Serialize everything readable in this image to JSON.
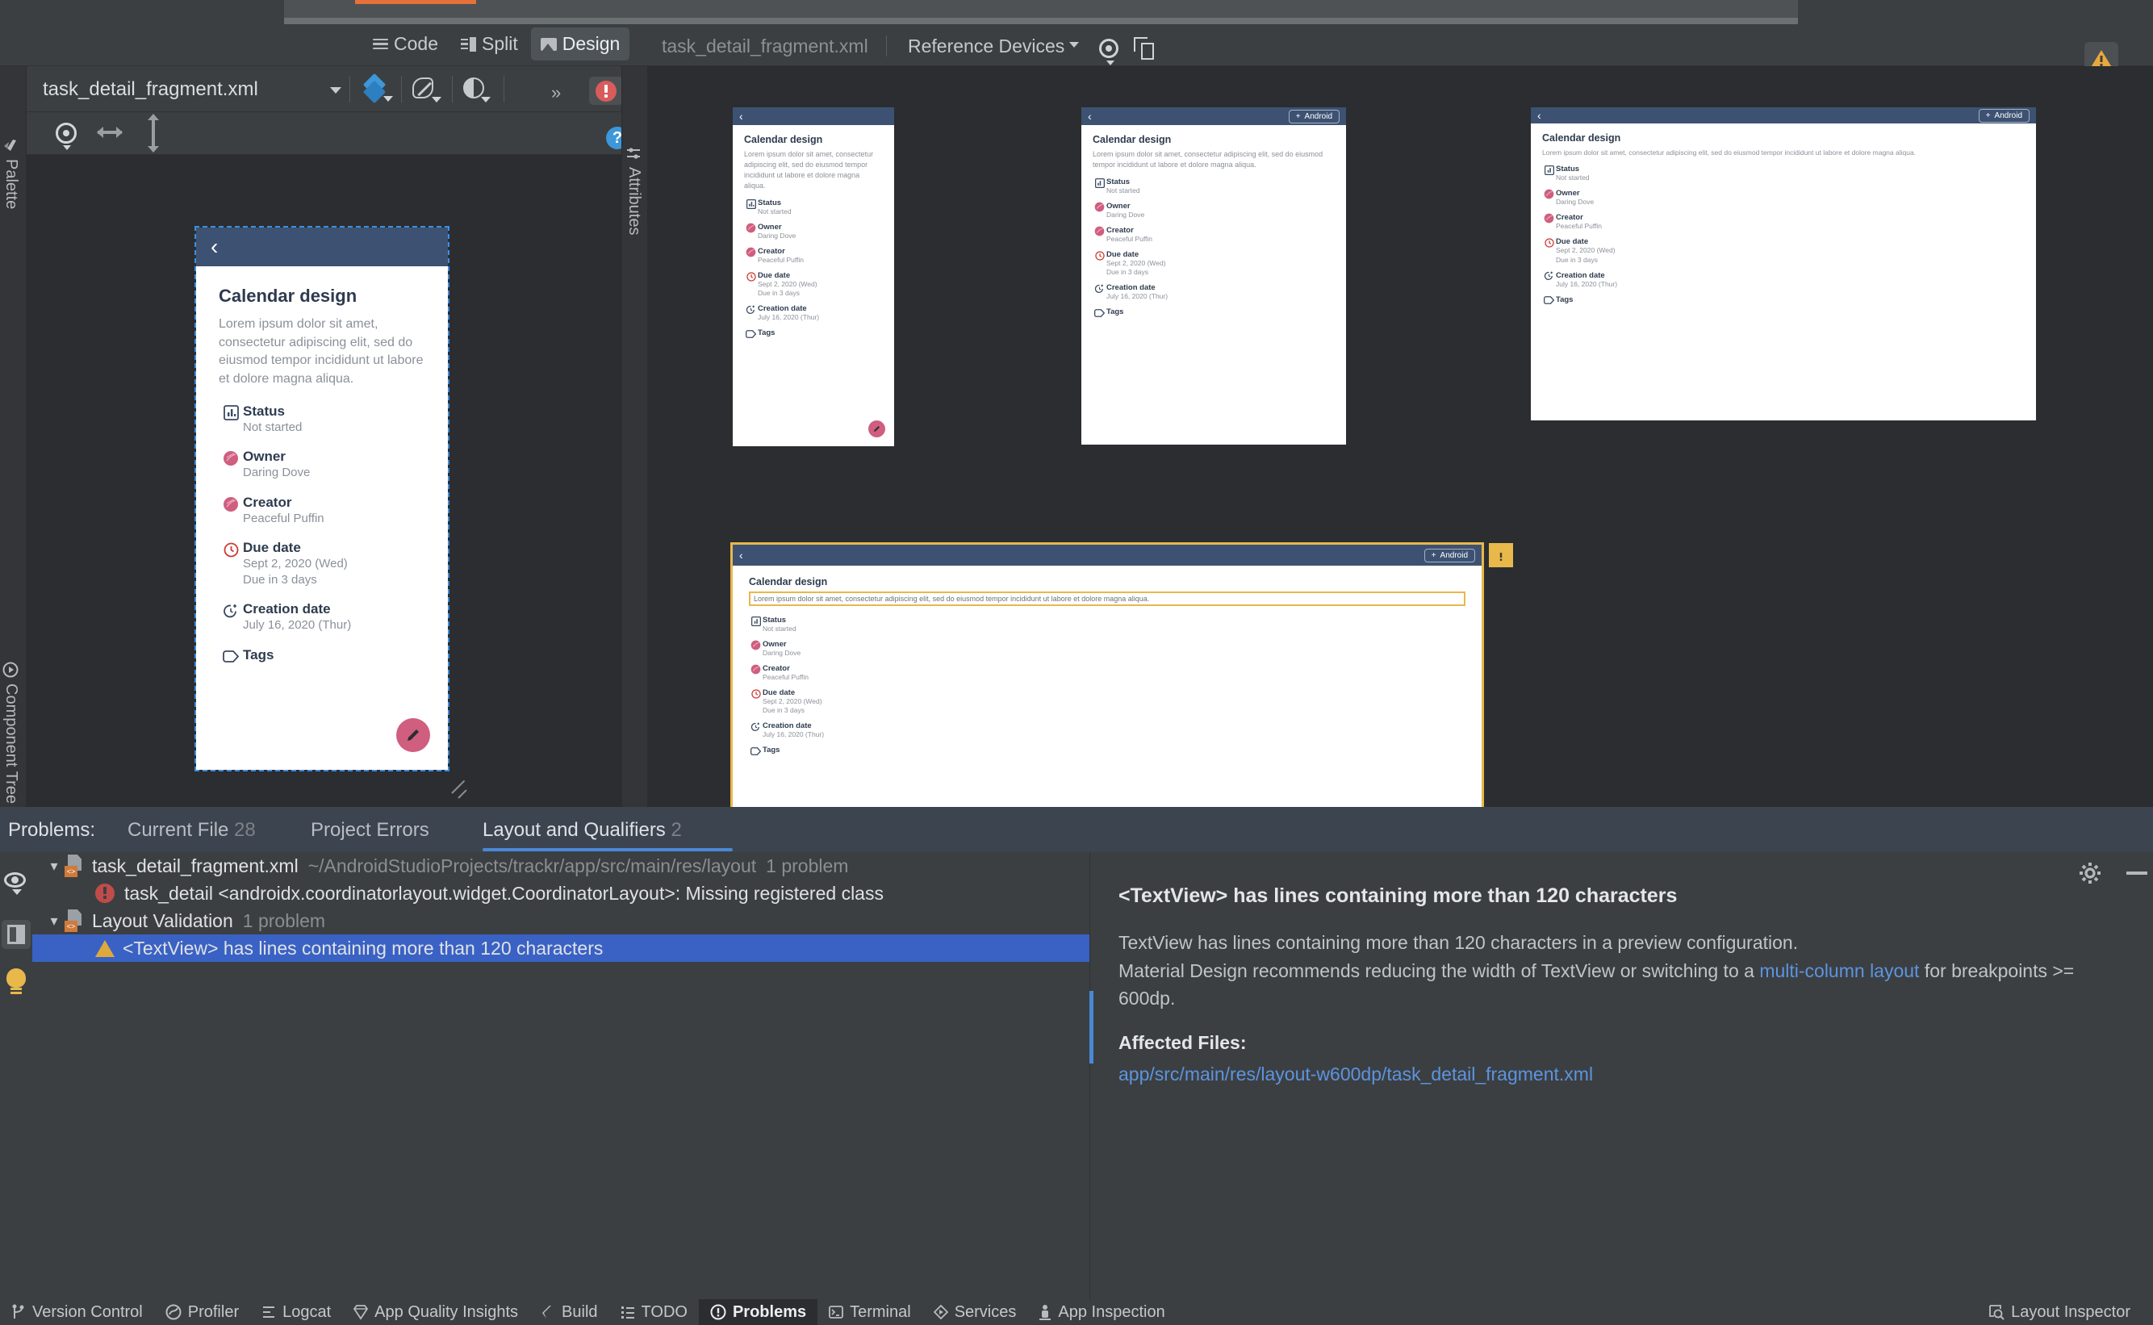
{
  "window": {
    "editor_mode_tabs": [
      {
        "label": "Code",
        "icon": "code-lines-icon",
        "active": false
      },
      {
        "label": "Split",
        "icon": "split-view-icon",
        "active": false
      },
      {
        "label": "Design",
        "icon": "design-view-icon",
        "active": true
      }
    ],
    "validation_toolbar": {
      "filename": "task_detail_fragment.xml",
      "config_label": "Reference Devices",
      "config_caret": "chevron-down-icon",
      "eye_icon": "visibility-icon",
      "copies_icon": "duplicate-windows-icon",
      "warning_icon": "warning-triangle-icon"
    }
  },
  "left_strip": {
    "palette_label": "Palette",
    "palette_icon": "palette-icon",
    "component_tree_label": "Component Tree",
    "component_tree_icon": "component-tree-icon"
  },
  "right_strip": {
    "attributes_label": "Attributes",
    "attributes_icon": "sliders-icon"
  },
  "design_toolbar": {
    "filename": "task_detail_fragment.xml",
    "filename_caret": "chevron-down-icon",
    "layers_icon": "design-surface-icon",
    "blueprint_icon": "blueprint-mode-icon",
    "orientation_icon": "night-mode-icon",
    "overflow_label": "»",
    "issues_icon": "error-circle-icon",
    "subbar": {
      "eye_icon": "view-options-icon",
      "width_icon": "horizontal-resize-icon",
      "height_icon": "vertical-resize-icon",
      "help_icon": "help-circle-icon",
      "help_label": "?"
    }
  },
  "preview_content": {
    "back_icon": "chevron-left-icon",
    "chip_label": "Android",
    "chip_plus": "+",
    "title": "Calendar design",
    "description": "Lorem ipsum dolor sit amet, consectetur adipiscing elit, sed do eiusmod tempor incididunt ut labore et dolore magna aliqua.",
    "fab_icon": "edit-pencil-icon",
    "rows": [
      {
        "icon": "status-chart-icon",
        "label": "Status",
        "value": "Not started",
        "value2": ""
      },
      {
        "icon": "owner-avatar-icon",
        "label": "Owner",
        "value": "Daring Dove",
        "value2": ""
      },
      {
        "icon": "creator-avatar-icon",
        "label": "Creator",
        "value": "Peaceful Puffin",
        "value2": ""
      },
      {
        "icon": "due-date-clock-icon",
        "label": "Due date",
        "value": "Sept 2, 2020 (Wed)",
        "value2": "Due in 3 days"
      },
      {
        "icon": "creation-date-clock-icon",
        "label": "Creation date",
        "value": "July 16, 2020 (Thur)",
        "value2": ""
      },
      {
        "icon": "tag-icon",
        "label": "Tags",
        "value": "",
        "value2": ""
      }
    ]
  },
  "problems_panel": {
    "title": "Problems:",
    "tabs": [
      {
        "label": "Current File",
        "count": "28",
        "active": false
      },
      {
        "label": "Project Errors",
        "count": "",
        "active": false
      },
      {
        "label": "Layout and Qualifiers",
        "count": "2",
        "active": true
      }
    ],
    "gear_icon": "settings-gear-icon",
    "minimize_icon": "minimize-icon",
    "side_icons": {
      "eye": "inspection-visibility-icon",
      "panel": "toggle-detail-panel-icon",
      "bulb": "quick-fix-bulb-icon"
    },
    "tree": [
      {
        "type": "file",
        "chevron": "chevron-expanded-icon",
        "icon": "xml-file-icon",
        "name": "task_detail_fragment.xml",
        "path": "~/AndroidStudioProjects/trackr/app/src/main/res/layout",
        "count": "1 problem",
        "selected": false
      },
      {
        "type": "error",
        "icon": "error-circle-icon",
        "name": "task_detail <androidx.coordinatorlayout.widget.CoordinatorLayout>: Missing registered class",
        "path": "",
        "count": "",
        "selected": false
      },
      {
        "type": "file",
        "chevron": "chevron-expanded-icon",
        "icon": "xml-file-icon",
        "name": "Layout Validation",
        "path": "",
        "count": "1 problem",
        "selected": false
      },
      {
        "type": "warning",
        "icon": "warning-triangle-icon",
        "name": "<TextView> has lines containing more than 120 characters",
        "path": "",
        "count": "",
        "selected": true
      }
    ],
    "detail": {
      "heading": "<TextView> has lines containing more than 120 characters",
      "body_line1": "TextView has lines containing more than 120 characters in a preview configuration.",
      "body_line2_pre": "Material Design recommends reducing the width of TextView or switching to a ",
      "body_link": "multi-column layout",
      "body_line2_post": " for breakpoints >= 600dp.",
      "affected_files_label": "Affected Files:",
      "affected_file": "app/src/main/res/layout-w600dp/task_detail_fragment.xml"
    }
  },
  "status_bar": {
    "items": [
      {
        "label": "Version Control",
        "icon": "branch-icon",
        "active": false
      },
      {
        "label": "Profiler",
        "icon": "profiler-icon",
        "active": false
      },
      {
        "label": "Logcat",
        "icon": "logcat-icon",
        "active": false
      },
      {
        "label": "App Quality Insights",
        "icon": "gem-icon",
        "active": false
      },
      {
        "label": "Build",
        "icon": "hammer-icon",
        "active": false
      },
      {
        "label": "TODO",
        "icon": "todo-list-icon",
        "active": false
      },
      {
        "label": "Problems",
        "icon": "problems-icon",
        "active": true
      },
      {
        "label": "Terminal",
        "icon": "terminal-icon",
        "active": false
      },
      {
        "label": "Services",
        "icon": "services-play-icon",
        "active": false
      },
      {
        "label": "App Inspection",
        "icon": "app-inspection-icon",
        "active": false
      }
    ],
    "right_items": [
      {
        "label": "Layout Inspector",
        "icon": "layout-inspector-icon",
        "active": false
      }
    ]
  },
  "colors": {
    "accent_blue": "#4a88d4",
    "selection_blue": "#3a62c4",
    "warning_yellow": "#e8b84b",
    "error_red": "#c04b4b",
    "appbar_navy": "#3d5272",
    "fab_pink": "#cf5e7f",
    "panel_bg": "#3c3f41",
    "canvas_bg": "#2b2d30"
  }
}
